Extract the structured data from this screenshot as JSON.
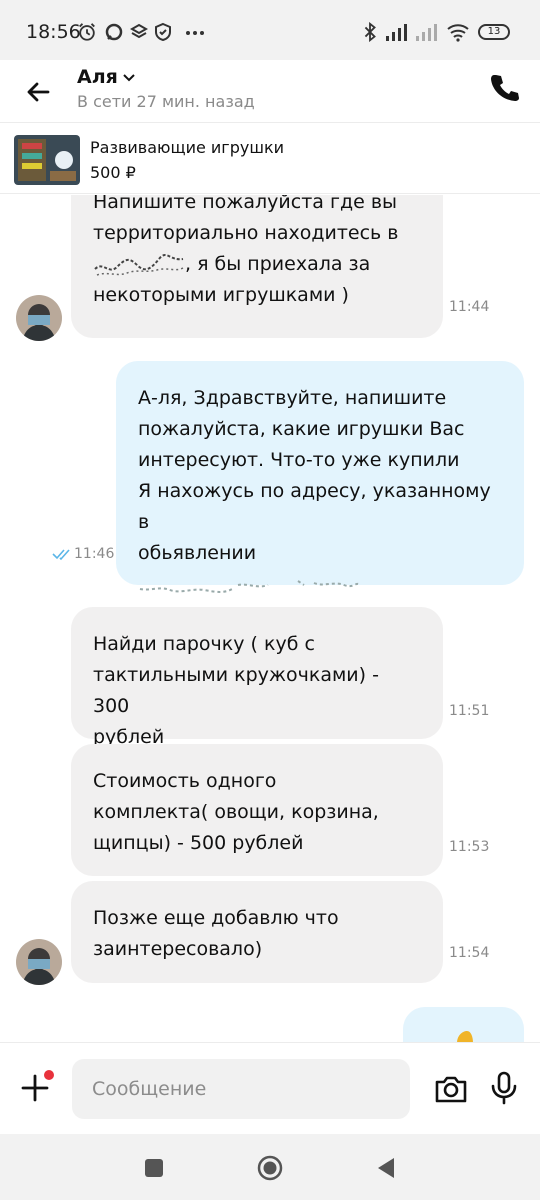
{
  "status_bar": {
    "time": "18:56",
    "battery": "13"
  },
  "header": {
    "contact_name": "Аля",
    "presence": "В сети 27 мин. назад"
  },
  "product": {
    "title": "Развивающие игрушки",
    "price": "500 ₽"
  },
  "messages": [
    {
      "direction": "incoming",
      "lines": [
        "Напишите пожалуйста где вы",
        "территориально находитесь в",
        ", я бы приехала за",
        "некоторыми игрушками )"
      ],
      "time": "11:44"
    },
    {
      "direction": "outgoing",
      "lines": [
        "А-ля, Здравствуйте, напишите",
        "пожалуйста, какие игрушки Вас",
        "интересуют. Что-то уже купили",
        "Я нахожусь по адресу, указанному в",
        "обьявлении"
      ],
      "time": "11:46"
    },
    {
      "direction": "incoming",
      "lines": [
        "Найди парочку ( куб с",
        "тактильными кружочками) - 300",
        "рублей"
      ],
      "time": "11:51"
    },
    {
      "direction": "incoming",
      "lines": [
        "Стоимость одного",
        "комплекта( овощи, корзина,",
        "щипцы) - 500 рублей"
      ],
      "time": "11:53"
    },
    {
      "direction": "incoming",
      "lines": [
        "Позже еще добавлю что",
        "заинтересовало)"
      ],
      "time": "11:54"
    }
  ],
  "composer": {
    "placeholder": "Сообщение"
  },
  "colors": {
    "incoming_bubble": "#f1f0f0",
    "outgoing_bubble": "#e3f4fd",
    "notification_dot": "#e8323c",
    "read_check": "#5bb6e8"
  }
}
